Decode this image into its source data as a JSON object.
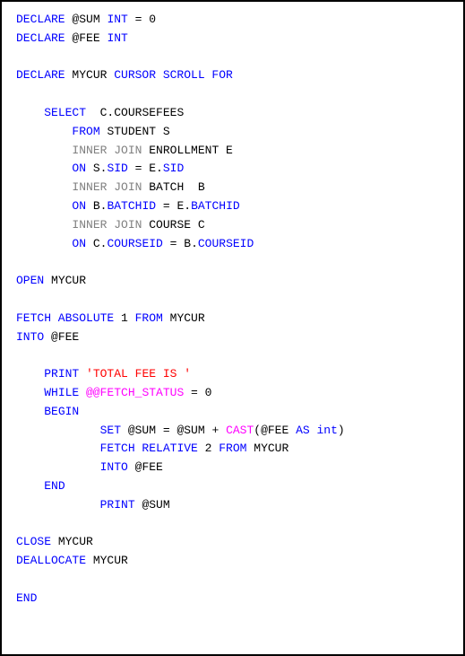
{
  "code": {
    "l1": {
      "declare": "DECLARE",
      "var": "@SUM ",
      "type": "INT",
      "eq": " = 0"
    },
    "l2": {
      "declare": "DECLARE",
      "var": "@FEE ",
      "type": "INT"
    },
    "l3": {
      "declare": "DECLARE",
      "name": " MYCUR ",
      "cursor": "CURSOR SCROLL FOR"
    },
    "l4": {
      "select": "SELECT",
      "cols": "  C.COURSEFEES"
    },
    "l5": {
      "from": "FROM",
      "tbl": " STUDENT S"
    },
    "l6": {
      "join": "INNER JOIN",
      "tbl": " ENROLLMENT E"
    },
    "l7": {
      "on": "ON",
      "lhs": " S.",
      "c1": "SID",
      "eq": " = E.",
      "c2": "SID"
    },
    "l8": {
      "join": "INNER JOIN",
      "tbl": " BATCH  B"
    },
    "l9": {
      "on": "ON",
      "lhs": " B.",
      "c1": "BATCHID",
      "eq": " = E.",
      "c2": "BATCHID"
    },
    "l10": {
      "join": "INNER JOIN",
      "tbl": " COURSE C"
    },
    "l11": {
      "on": "ON",
      "lhs": " C.",
      "c1": "COURSEID",
      "eq": " = B.",
      "c2": "COURSEID"
    },
    "l12": {
      "open": "OPEN",
      "name": " MYCUR"
    },
    "l13": {
      "fetch": "FETCH ABSOLUTE",
      "n": " 1 ",
      "from": "FROM",
      "name": " MYCUR"
    },
    "l14": {
      "into": "INTO",
      "var": " @FEE"
    },
    "l15": {
      "print": "PRINT ",
      "str": "'TOTAL FEE IS '"
    },
    "l16": {
      "while": "WHILE ",
      "fs": "@@FETCH_STATUS",
      "eq": " = 0"
    },
    "l17": {
      "begin": "BEGIN"
    },
    "l18": {
      "set": "SET",
      "expr1": " @SUM = @SUM + ",
      "cast": "CAST",
      "p1": "(@FEE ",
      "as": "AS int",
      "p2": ")"
    },
    "l19": {
      "fetch": "FETCH RELATIVE",
      "n": " 2 ",
      "from": "FROM",
      "name": " MYCUR"
    },
    "l20": {
      "into": "INTO",
      "var": " @FEE"
    },
    "l21": {
      "end": "END"
    },
    "l22": {
      "print": "PRINT",
      "var": " @SUM"
    },
    "l23": {
      "close": "CLOSE",
      "name": " MYCUR"
    },
    "l24": {
      "dealloc": "DEALLOCATE",
      "name": " MYCUR"
    },
    "l25": {
      "end": "END"
    }
  }
}
